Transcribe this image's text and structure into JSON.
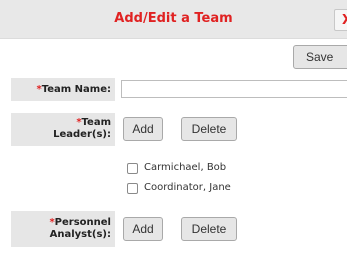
{
  "dialog": {
    "title": "Add/Edit a Team",
    "close_label": "X",
    "save_label": "Save"
  },
  "form": {
    "team_name": {
      "required_mark": "*",
      "label": "Team Name:",
      "value": ""
    },
    "team_leaders": {
      "required_mark": "*",
      "label_line1": "Team",
      "label_line2": "Leader(s):",
      "add_label": "Add",
      "delete_label": "Delete",
      "members": [
        {
          "name": "Carmichael, Bob",
          "checked": false
        },
        {
          "name": "Coordinator, Jane",
          "checked": false
        }
      ]
    },
    "personnel_analysts": {
      "required_mark": "*",
      "label_line1": "Personnel",
      "label_line2": "Analyst(s):",
      "add_label": "Add",
      "delete_label": "Delete"
    }
  }
}
